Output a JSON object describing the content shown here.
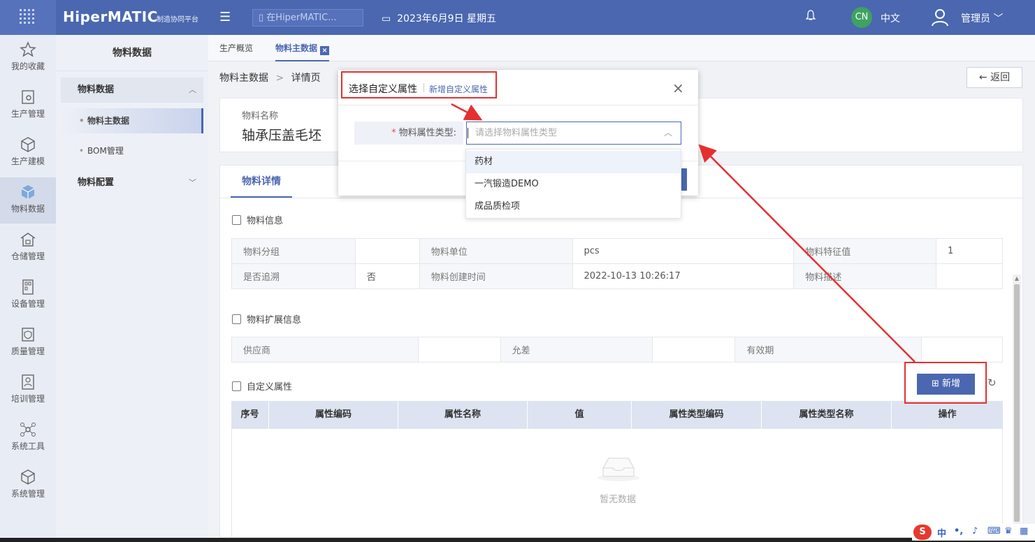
{
  "header": {
    "brand": "HiperMATIC",
    "brand_sub": "制造协同平台",
    "search_placeholder": "在HiperMATIC...",
    "date": "2023年6月9日 星期五",
    "lang_badge": "CN",
    "lang": "中文",
    "user": "管理员"
  },
  "rail": {
    "items": [
      {
        "label": "我的收藏",
        "icon": "star-icon"
      },
      {
        "label": "生产管理",
        "icon": "clipboard-icon"
      },
      {
        "label": "生产建模",
        "icon": "cube-icon"
      },
      {
        "label": "物料数据",
        "icon": "box-icon"
      },
      {
        "label": "仓储管理",
        "icon": "warehouse-icon"
      },
      {
        "label": "设备管理",
        "icon": "device-icon"
      },
      {
        "label": "质量管理",
        "icon": "shield-icon"
      },
      {
        "label": "培训管理",
        "icon": "person-icon"
      },
      {
        "label": "系统工具",
        "icon": "network-icon"
      },
      {
        "label": "系统管理",
        "icon": "cube-icon"
      }
    ]
  },
  "sidebar": {
    "title": "物料数据",
    "group1": "物料数据",
    "sub1": "物料主数据",
    "sub2": "BOM管理",
    "group2": "物料配置"
  },
  "tabs": {
    "tab1": "生产概览",
    "tab2": "物料主数据",
    "tab2_close": "×"
  },
  "main": {
    "breadcrumb_root": "物料主数据",
    "breadcrumb_sep": ">",
    "breadcrumb_current": "详情页",
    "back": "返回",
    "name_label": "物料名称",
    "name_value": "轴承压盖毛坯",
    "detail_tab": "物料详情",
    "section_info": "物料信息",
    "info_rows": [
      [
        "物料分组",
        "",
        "物料单位",
        "pcs",
        "物料特征值",
        "1"
      ],
      [
        "是否追溯",
        "否",
        "物料创建时间",
        "2022-10-13 10:26:17",
        "物料描述",
        ""
      ]
    ],
    "section_ext": "物料扩展信息",
    "ext_row": [
      "供应商",
      "",
      "允差",
      "",
      "有效期",
      ""
    ],
    "section_custom": "自定义属性",
    "add_button": "新增",
    "columns": [
      "序号",
      "属性编码",
      "属性名称",
      "值",
      "属性类型编码",
      "属性类型名称",
      "操作"
    ],
    "empty_text": "暂无数据"
  },
  "modal": {
    "title": "选择自定义属性",
    "link": "新增自定义属性",
    "close": "×",
    "field_label": "物料属性类型:",
    "required_mark": "*",
    "select_placeholder": "请选择物料属性类型",
    "options": [
      "药材",
      "一汽锻造DEMO",
      "成品质检项"
    ]
  },
  "colors": {
    "primary": "#4a67b0",
    "annotation": "#e53030"
  }
}
